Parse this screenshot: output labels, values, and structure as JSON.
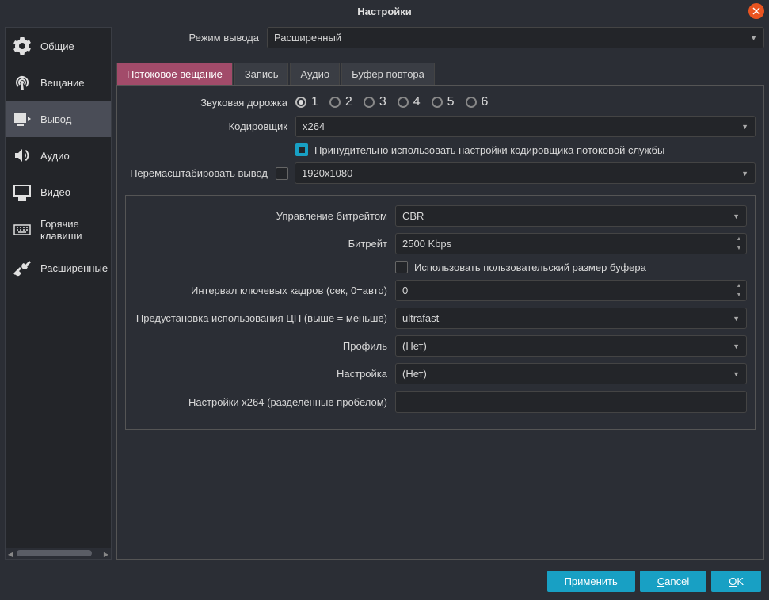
{
  "window": {
    "title": "Настройки"
  },
  "sidebar": {
    "items": [
      {
        "label": "Общие"
      },
      {
        "label": "Вещание"
      },
      {
        "label": "Вывод"
      },
      {
        "label": "Аудио"
      },
      {
        "label": "Видео"
      },
      {
        "label": "Горячие клавиши"
      },
      {
        "label": "Расширенные"
      }
    ]
  },
  "output_mode": {
    "label": "Режим вывода",
    "value": "Расширенный"
  },
  "tabs": [
    {
      "label": "Потоковое вещание"
    },
    {
      "label": "Запись"
    },
    {
      "label": "Аудио"
    },
    {
      "label": "Буфер повтора"
    }
  ],
  "streaming": {
    "audio_track_label": "Звуковая дорожка",
    "tracks": [
      "1",
      "2",
      "3",
      "4",
      "5",
      "6"
    ],
    "encoder_label": "Кодировщик",
    "encoder_value": "x264",
    "enforce_label": "Принудительно использовать настройки кодировщика потоковой службы",
    "rescale_label": "Перемасштабировать вывод",
    "rescale_value": "1920x1080"
  },
  "encoder": {
    "rate_control_label": "Управление битрейтом",
    "rate_control_value": "CBR",
    "bitrate_label": "Битрейт",
    "bitrate_value": "2500 Kbps",
    "custom_buffer_label": "Использовать пользовательский размер буфера",
    "keyframe_label": "Интервал ключевых кадров (сек, 0=авто)",
    "keyframe_value": "0",
    "cpu_preset_label": "Предустановка использования ЦП (выше = меньше)",
    "cpu_preset_value": "ultrafast",
    "profile_label": "Профиль",
    "profile_value": "(Нет)",
    "tune_label": "Настройка",
    "tune_value": "(Нет)",
    "x264opts_label": "Настройки x264 (разделённые пробелом)"
  },
  "footer": {
    "apply": "Применить",
    "cancel": "Cancel",
    "ok": "OK"
  }
}
